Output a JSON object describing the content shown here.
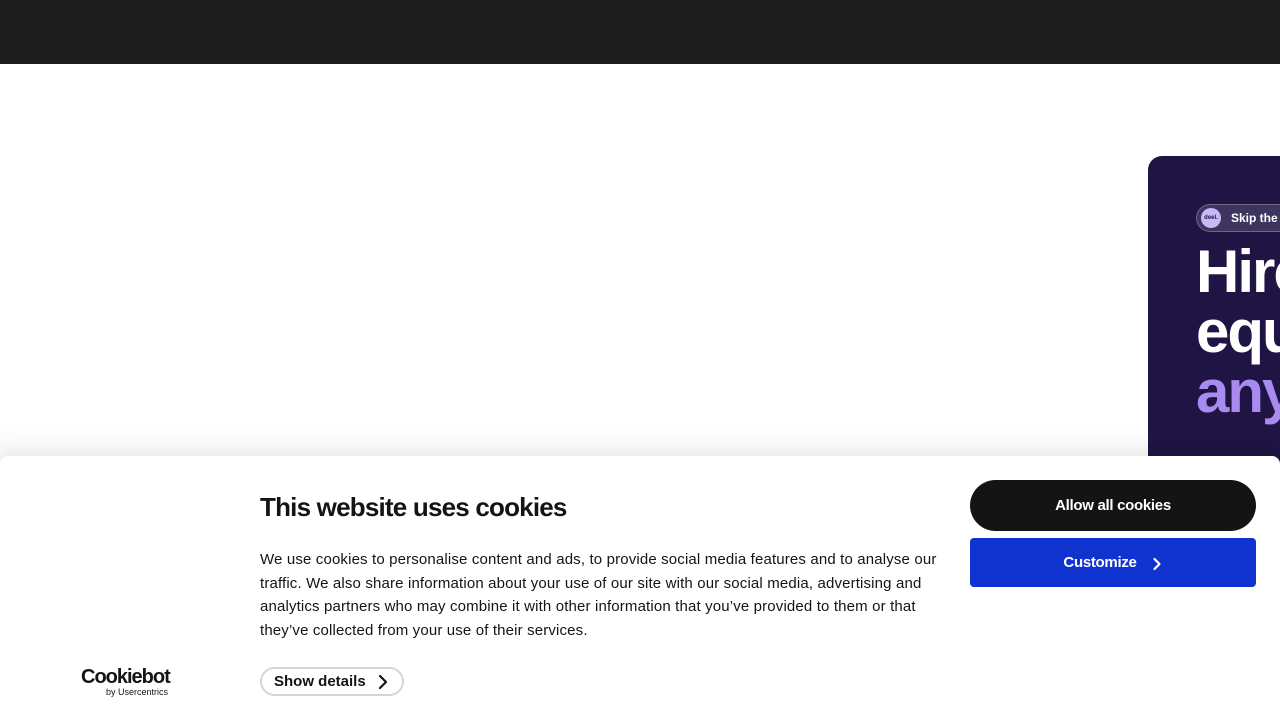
{
  "hero": {
    "pill_logo": "deel.",
    "pill_text": "Skip the",
    "title_line1": "Hire",
    "title_line2": "equ",
    "title_line3": "any"
  },
  "cookie_banner": {
    "title": "This website uses cookies",
    "body": "We use cookies to personalise content and ads, to provide social media features and to analyse our traffic. We also share information about your use of our site with our social media, advertising and analytics partners who may combine it with other information that you’ve provided to them or that they’ve collected from your use of their services.",
    "show_details_label": "Show details",
    "allow_all_label": "Allow all cookies",
    "customize_label": "Customize",
    "brand": "Cookiebot",
    "brand_sub": "by Usercentrics",
    "chevron_icon": "chevron-right-icon"
  },
  "colors": {
    "topbar": "#1c1c1c",
    "hero_bg": "#1f1444",
    "hero_accent": "#a98bf0",
    "allow_button": "#141414",
    "customize_button": "#1032cf"
  }
}
